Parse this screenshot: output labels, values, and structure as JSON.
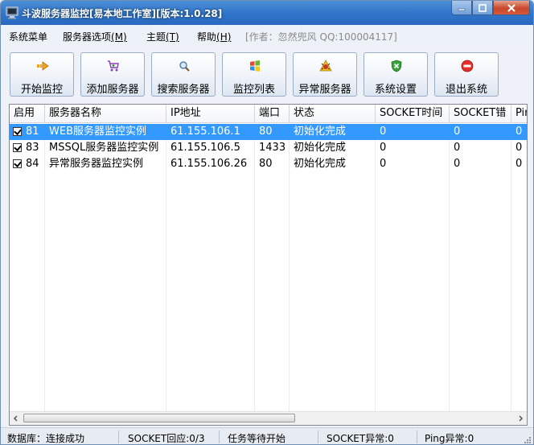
{
  "window": {
    "title": "斗波服务器监控[易本地工作室][版本:1.0.28]"
  },
  "menu": {
    "items": [
      {
        "label": "系统菜单",
        "accel": ""
      },
      {
        "label": "服务器选项",
        "accel": "(M)"
      },
      {
        "label": "主题",
        "accel": "(T)"
      },
      {
        "label": "帮助",
        "accel": "(H)"
      }
    ],
    "author": "[作者：忽然兜风 QQ:100004117]"
  },
  "toolbar": {
    "buttons": [
      {
        "label": "开始监控",
        "icon": "arrow-right-icon"
      },
      {
        "label": "添加服务器",
        "icon": "cart-add-icon"
      },
      {
        "label": "搜索服务器",
        "icon": "magnifier-icon"
      },
      {
        "label": "监控列表",
        "icon": "windows-flag-icon"
      },
      {
        "label": "异常服务器",
        "icon": "warning-bug-icon"
      },
      {
        "label": "系统设置",
        "icon": "shield-settings-icon"
      },
      {
        "label": "退出系统",
        "icon": "stop-icon"
      }
    ]
  },
  "grid": {
    "columns": [
      "启用",
      "服务器名称",
      "IP地址",
      "端口",
      "状态",
      "SOCKET时间",
      "SOCKET错",
      "Pin"
    ],
    "rows": [
      {
        "enabled": true,
        "id": "81",
        "name": "WEB服务器监控实例",
        "ip": "61.155.106.1",
        "port": "80",
        "status": "初始化完成",
        "socket_time": "0",
        "socket_err": "0",
        "ping": "0",
        "selected": true
      },
      {
        "enabled": true,
        "id": "83",
        "name": "MSSQL服务器监控实例",
        "ip": "61.155.106.5",
        "port": "1433",
        "status": "初始化完成",
        "socket_time": "0",
        "socket_err": "0",
        "ping": "0",
        "selected": false
      },
      {
        "enabled": true,
        "id": "84",
        "name": "异常服务器监控实例",
        "ip": "61.155.106.26",
        "port": "80",
        "status": "初始化完成",
        "socket_time": "0",
        "socket_err": "0",
        "ping": "0",
        "selected": false
      }
    ]
  },
  "status": {
    "db": "数据库：连接成功",
    "socket_reply": "SOCKET回应:0/3",
    "task": "任务等待开始",
    "socket_err": "SOCKET异常:0",
    "ping_err": "Ping异常:0"
  }
}
